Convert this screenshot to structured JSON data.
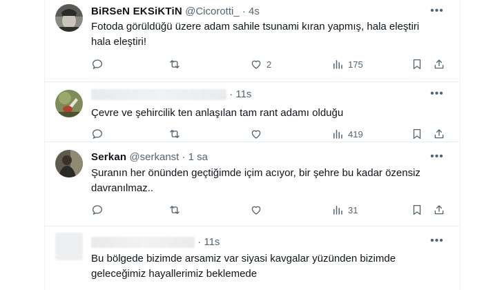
{
  "tweets": [
    {
      "name": "BiRSeN EKSiKTiN",
      "handle": "@Cicorotti_",
      "dot": "·",
      "time": "4s",
      "text_lines": [
        "Fotoda görüldüğü üzere adam sahile tsunami kıran yapmış, hala eleştiri",
        "hala eleştiri!"
      ],
      "likes": "2",
      "views": "175"
    },
    {
      "name": "",
      "handle": "",
      "dot": "·",
      "time": "11s",
      "text_lines": [
        "Çevre ve şehircilik ten anlaşılan tam rant adamı olduğu"
      ],
      "likes": "",
      "views": "419"
    },
    {
      "name": "Serkan",
      "handle": "@serkanst",
      "dot": "·",
      "time": "1 sa",
      "text_lines": [
        "Şuranın her önünden geçtiğimde içim acıyor, bir şehre bu kadar özensiz",
        "davranılmaz.."
      ],
      "likes": "",
      "views": "31"
    },
    {
      "name": "",
      "handle": "",
      "dot": "·",
      "time": "11s",
      "text_lines": [
        "Bu bölgede bizimde arsamiz var siyasi kavgalar yüzünden bizimde",
        "geleceğimiz hayallerimiz beklemede"
      ],
      "likes": "",
      "views": ""
    }
  ],
  "more_glyph": "•••",
  "icons": [
    "reply-icon",
    "retweet-icon",
    "like-icon",
    "views-icon",
    "bookmark-icon",
    "share-icon",
    "more-icon"
  ],
  "colors": {
    "text": "#0f1419",
    "secondary": "#536471",
    "divider": "#e6ecf0"
  }
}
